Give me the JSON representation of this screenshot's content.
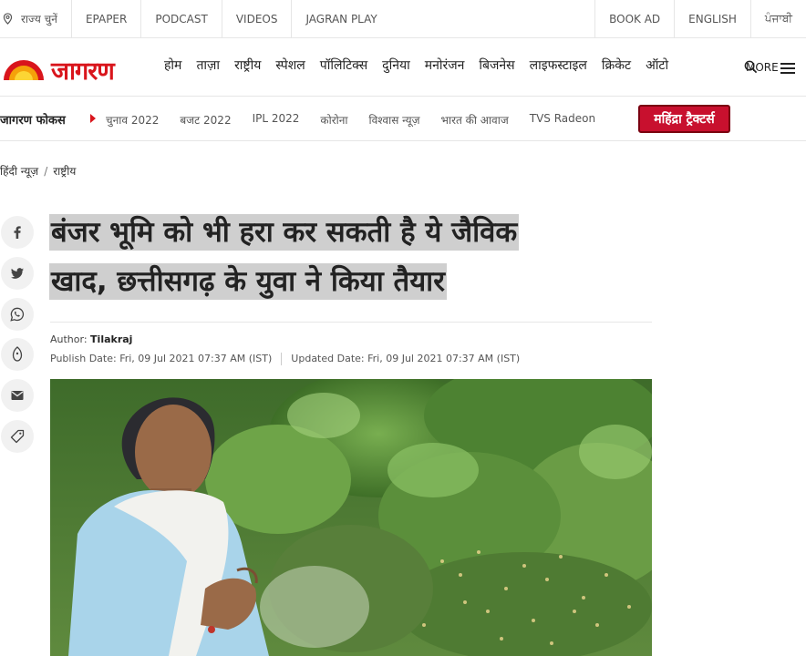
{
  "topbar": {
    "state_select": "राज्य चुनें",
    "epaper": "EPAPER",
    "podcast": "PODCAST",
    "videos": "VIDEOS",
    "jagran_play": "JAGRAN PLAY",
    "book_ad": "BOOK AD",
    "english": "ENGLISH",
    "punjabi": "ਪੰਜਾਬੀ"
  },
  "logo": {
    "text": "जागरण"
  },
  "nav": {
    "items": [
      "होम",
      "ताज़ा",
      "राष्ट्रीय",
      "स्पेशल",
      "पॉलिटिक्स",
      "दुनिया",
      "मनोरंजन",
      "बिजनेस",
      "लाइफस्टाइल",
      "क्रिकेट",
      "ऑटो"
    ],
    "more": "MORE"
  },
  "focus": {
    "title": "जागरण फोकस",
    "items": [
      "चुनाव 2022",
      "बजट 2022",
      "IPL 2022",
      "कोरोना",
      "विश्वास न्यूज़",
      "भारत की आवाज",
      "TVS Radeon"
    ],
    "ad_label": "महिंद्रा ट्रैक्टर्स"
  },
  "breadcrumb": {
    "home": "हिंदी न्यूज़",
    "separator": "/",
    "section": "राष्ट्रीय"
  },
  "article": {
    "headline_line1": "बंजर भूमि को भी हरा कर सकती है ये जैविक",
    "headline_line2": "खाद, छत्तीसगढ़ के युवा ने किया तैयार",
    "author_label": "Author:",
    "author_name": "Tilakraj",
    "publish_date": "Publish Date: Fri, 09 Jul 2021 07:37 AM (IST)",
    "updated_date": "Updated Date: Fri, 09 Jul 2021 07:37 AM (IST)"
  },
  "share_icons": [
    "facebook-icon",
    "twitter-icon",
    "whatsapp-icon",
    "koo-icon",
    "email-icon",
    "tag-icon"
  ],
  "colors": {
    "brand_red": "#d9151c",
    "highlight": "#cfcfcf"
  }
}
